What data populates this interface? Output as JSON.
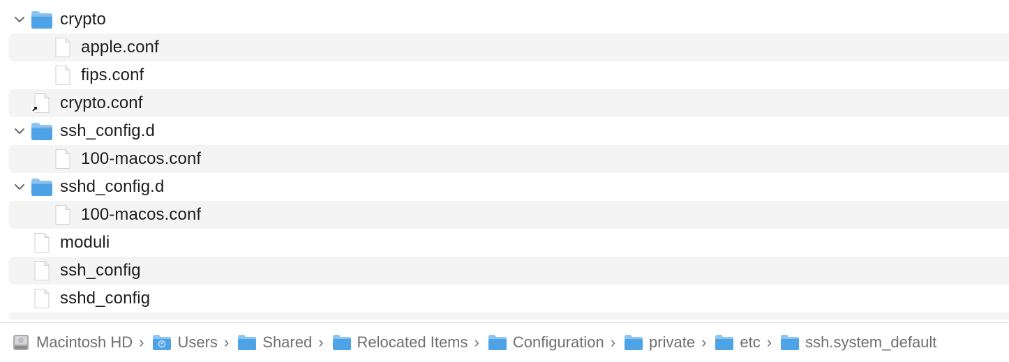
{
  "file_list": {
    "rows": [
      {
        "name": "crypto",
        "kind": "folder",
        "expanded": true,
        "level": 0,
        "alt": false
      },
      {
        "name": "apple.conf",
        "kind": "file",
        "level": 1,
        "alt": true
      },
      {
        "name": "fips.conf",
        "kind": "file",
        "level": 1,
        "alt": false
      },
      {
        "name": "crypto.conf",
        "kind": "alias",
        "level": 0,
        "alt": true
      },
      {
        "name": "ssh_config.d",
        "kind": "folder",
        "expanded": true,
        "level": 0,
        "alt": false
      },
      {
        "name": "100-macos.conf",
        "kind": "file",
        "level": 1,
        "alt": true
      },
      {
        "name": "sshd_config.d",
        "kind": "folder",
        "expanded": true,
        "level": 0,
        "alt": false
      },
      {
        "name": "100-macos.conf",
        "kind": "file",
        "level": 1,
        "alt": true
      },
      {
        "name": "moduli",
        "kind": "file",
        "level": 0,
        "alt": false
      },
      {
        "name": "ssh_config",
        "kind": "file",
        "level": 0,
        "alt": true
      },
      {
        "name": "sshd_config",
        "kind": "file",
        "level": 0,
        "alt": false
      }
    ]
  },
  "path_bar": {
    "items": [
      {
        "label": "Macintosh HD",
        "icon": "hard-drive-icon"
      },
      {
        "label": "Users",
        "icon": "users-folder-icon"
      },
      {
        "label": "Shared",
        "icon": "folder-icon"
      },
      {
        "label": "Relocated Items",
        "icon": "folder-icon"
      },
      {
        "label": "Configuration",
        "icon": "folder-icon"
      },
      {
        "label": "private",
        "icon": "folder-icon"
      },
      {
        "label": "etc",
        "icon": "folder-icon"
      },
      {
        "label": "ssh.system_default",
        "icon": "folder-icon"
      }
    ],
    "separator": "›"
  },
  "colors": {
    "folder_top": "#8cc6f0",
    "folder_body": "#4da3e6",
    "row_alt": "#f4f4f4",
    "path_text": "#6e6e73"
  }
}
